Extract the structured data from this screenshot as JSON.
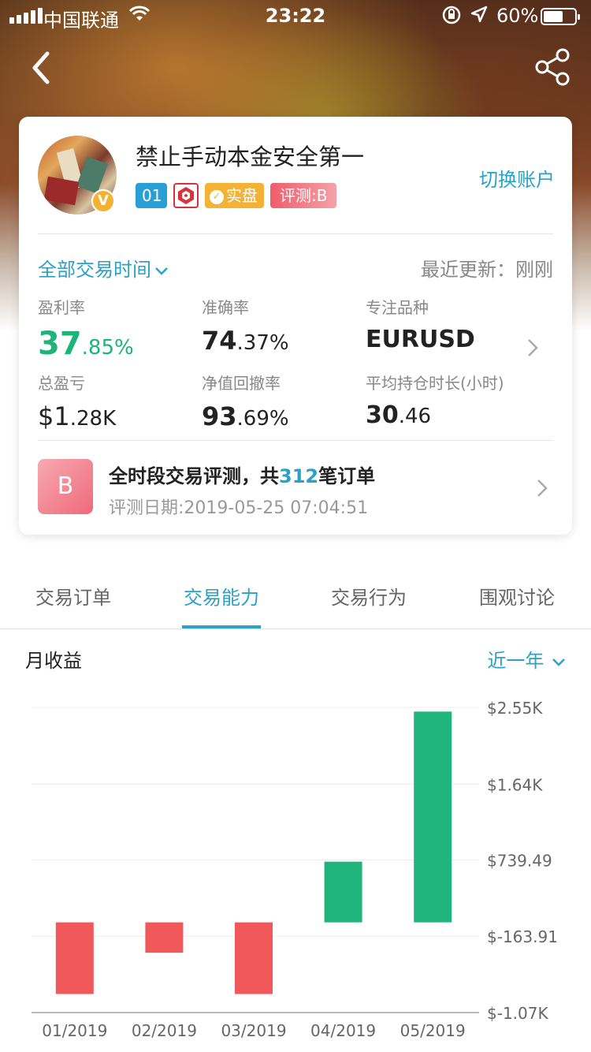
{
  "status_bar": {
    "carrier": "中国联通",
    "time": "23:22",
    "battery": "60%"
  },
  "nav": {
    "back_icon": "back-arrow-icon",
    "share_icon": "share-icon"
  },
  "profile": {
    "name": "禁止手动本金安全第一",
    "switch_account": "切换账户",
    "verified_badge": "V",
    "badges": {
      "level": "01",
      "real": "实盘",
      "rating": "评测:B"
    }
  },
  "summary": {
    "time_filter": "全部交易时间",
    "update_label": "最近更新：刚刚",
    "stats": [
      {
        "label": "盈利率",
        "big": "37",
        "small": ".85%"
      },
      {
        "label": "准确率",
        "big": "74",
        "small": ".37%"
      },
      {
        "label": "专注品种",
        "big": "EURUSD",
        "small": ""
      },
      {
        "label": "总盈亏",
        "big": "$1",
        "small": ".28K"
      },
      {
        "label": "净值回撤率",
        "big": "93",
        "small": ".69%"
      },
      {
        "label": "平均持仓时长(小时)",
        "big": "30",
        "small": ".46"
      }
    ]
  },
  "evaluation": {
    "icon_letter": "B",
    "title_prefix": "全时段交易评测，共",
    "order_count": "312",
    "title_suffix": "笔订单",
    "date": "评测日期:2019-05-25 07:04:51"
  },
  "tabs": [
    {
      "label": "交易订单"
    },
    {
      "label": "交易能力"
    },
    {
      "label": "交易行为"
    },
    {
      "label": "围观讨论"
    }
  ],
  "chart_section": {
    "title": "月收益",
    "period": "近一年"
  },
  "chart_data": {
    "type": "bar",
    "categories": [
      "01/2019",
      "02/2019",
      "03/2019",
      "04/2019",
      "05/2019"
    ],
    "values": [
      -850,
      -360,
      -850,
      720,
      2500
    ],
    "ytick_labels": [
      "$2.55K",
      "$1.64K",
      "$739.49",
      "$-163.91",
      "$-1.07K"
    ],
    "ytick_values": [
      2550,
      1640,
      739.49,
      -163.91,
      -1070
    ],
    "ylim": [
      -1070,
      2550
    ],
    "baseline": 0,
    "colors": {
      "positive": "#1fb57c",
      "negative": "#f0585a"
    }
  }
}
